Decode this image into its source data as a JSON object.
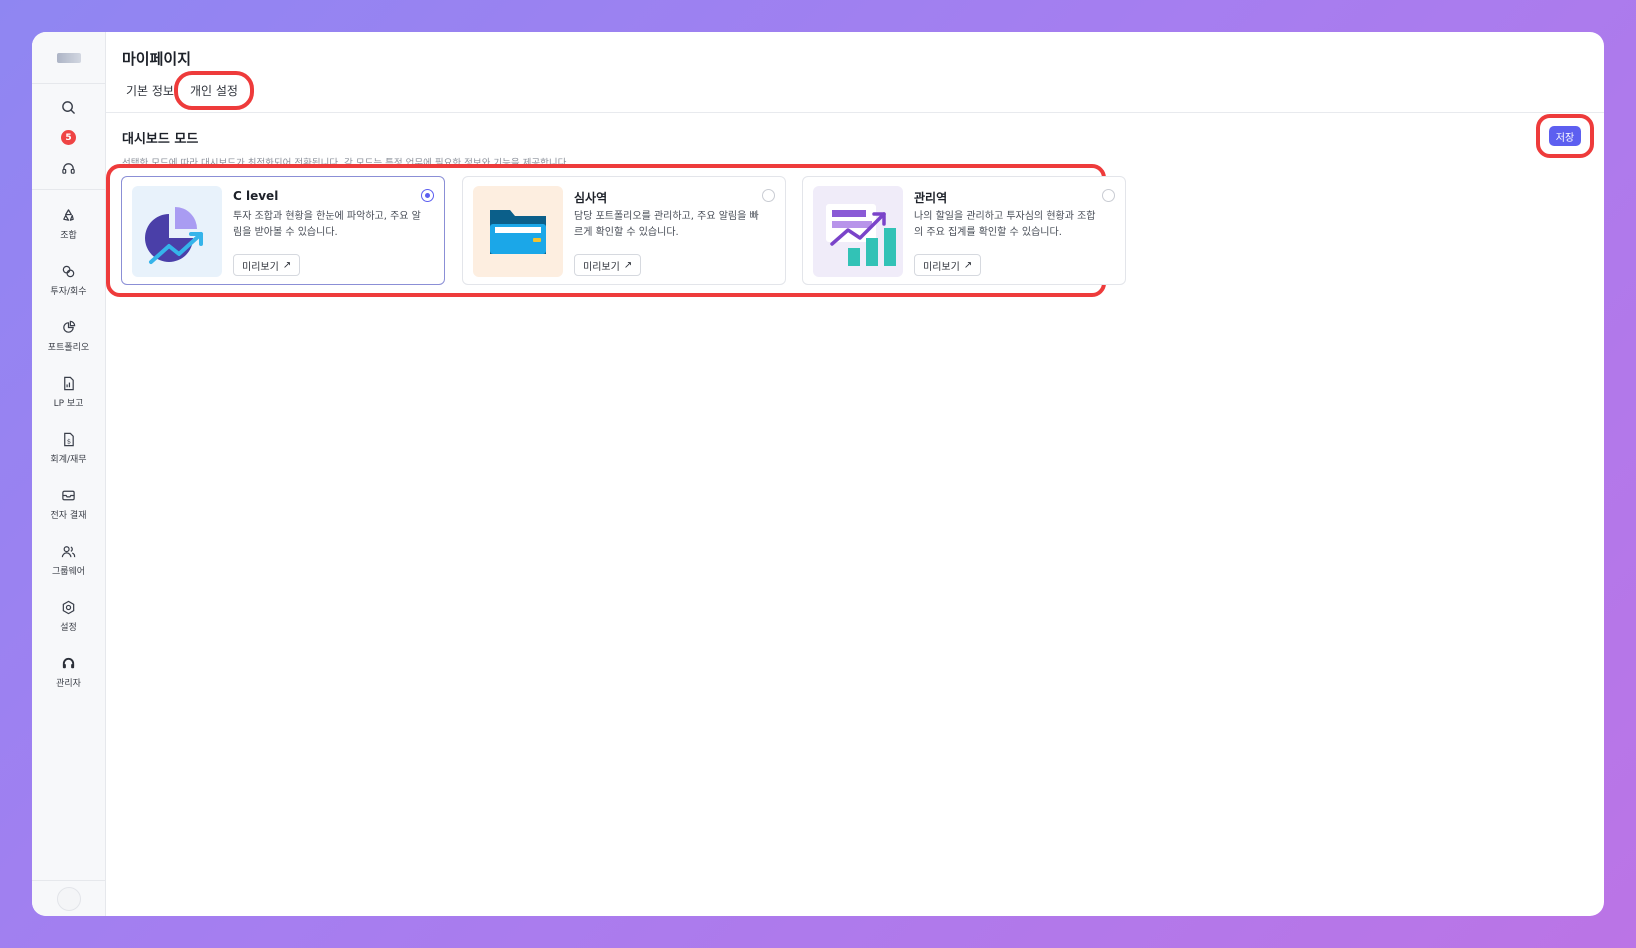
{
  "page": {
    "title": "마이페이지",
    "tabs": [
      "기본 정보",
      "개인 설정"
    ]
  },
  "sidebar": {
    "notification_count": "5",
    "items": [
      {
        "label": "조합",
        "icon": "recycle-icon"
      },
      {
        "label": "투자/회수",
        "icon": "exchange-icon"
      },
      {
        "label": "포트폴리오",
        "icon": "pie-chart-icon"
      },
      {
        "label": "LP 보고",
        "icon": "report-icon"
      },
      {
        "label": "회계/재무",
        "icon": "finance-doc-icon"
      },
      {
        "label": "전자 결재",
        "icon": "mail-icon"
      },
      {
        "label": "그룹웨어",
        "icon": "users-icon"
      },
      {
        "label": "설정",
        "icon": "gear-icon"
      },
      {
        "label": "관리자",
        "icon": "headset-icon"
      }
    ]
  },
  "section": {
    "title": "대시보드 모드",
    "description": "선택한 모드에 따라 대시보드가 최적화되어 전환됩니다. 각 모드는 특정 업무에 필요한 정보와 기능을 제공합니다.",
    "save_label": "저장"
  },
  "modes": [
    {
      "title": "C level",
      "description": "투자 조합과 현황을 한눈에 파악하고, 주요 알림을 받아볼 수 있습니다.",
      "preview_label": "미리보기",
      "selected": true
    },
    {
      "title": "심사역",
      "description": "담당 포트폴리오를 관리하고, 주요 알림을 빠르게 확인할 수 있습니다.",
      "preview_label": "미리보기",
      "selected": false
    },
    {
      "title": "관리역",
      "description": "나의 할일을 관리하고 투자심의 현황과 조합의 주요 집계를 확인할 수 있습니다.",
      "preview_label": "미리보기",
      "selected": false
    }
  ],
  "colors": {
    "accent": "#5d5ff0",
    "highlight": "#ee3b3b",
    "clevel_bg": "#e8f2fb",
    "reviewer_bg": "#fdeee0",
    "manager_bg": "#f0ecf9"
  }
}
